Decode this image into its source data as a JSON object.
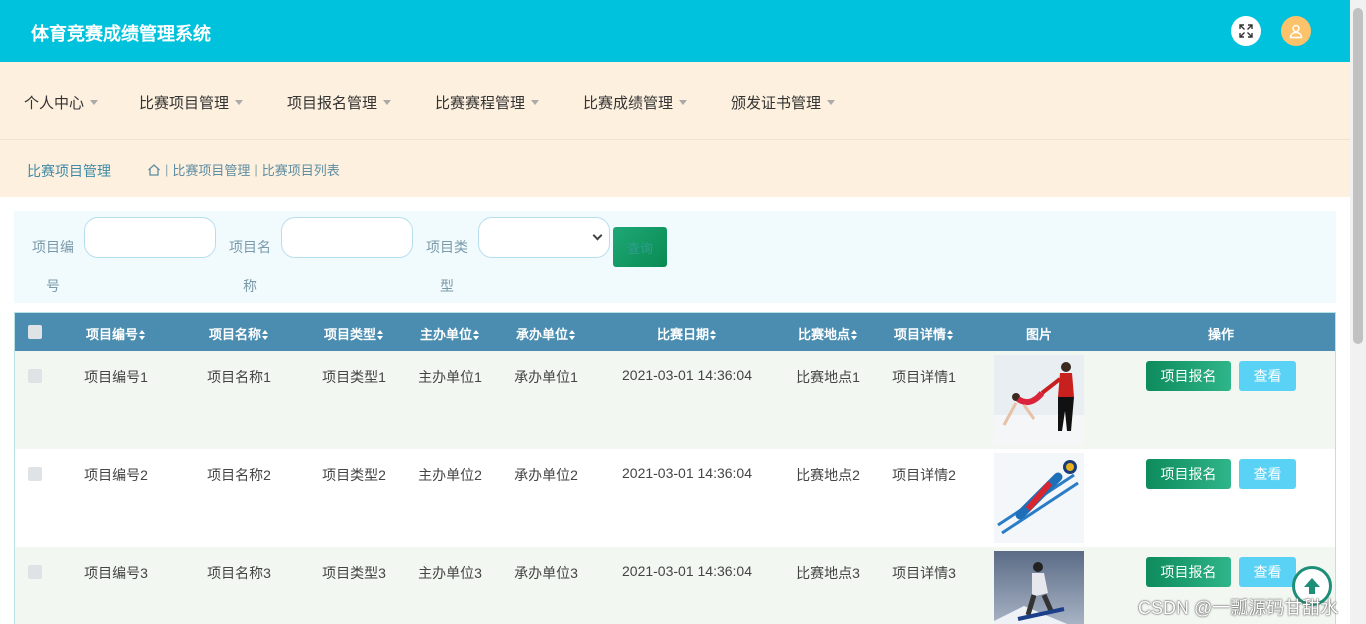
{
  "header": {
    "title": "体育竞赛成绩管理系统",
    "fullscreen_icon": "expand-icon",
    "user_icon": "user-icon",
    "user_color": "#fcc36a",
    "bg_color": "#00c2dc"
  },
  "nav": {
    "items": [
      {
        "label": "个人中心"
      },
      {
        "label": "比赛项目管理"
      },
      {
        "label": "项目报名管理"
      },
      {
        "label": "比赛赛程管理"
      },
      {
        "label": "比赛成绩管理"
      },
      {
        "label": "颁发证书管理"
      }
    ]
  },
  "breadcrumb": {
    "title": "比赛项目管理",
    "home_icon": "home-icon",
    "sep": "|",
    "level1": "比赛项目管理",
    "level2": "比赛项目列表"
  },
  "search": {
    "field1_label": "项目编号",
    "field2_label": "项目名称",
    "field3_label": "项目类型",
    "field1_value": "",
    "field2_value": "",
    "field3_value": "",
    "query_label": "查询"
  },
  "table": {
    "headers": [
      "项目编号",
      "项目名称",
      "项目类型",
      "主办单位",
      "承办单位",
      "比赛日期",
      "比赛地点",
      "项目详情",
      "图片",
      "操作"
    ],
    "rows": [
      {
        "code": "项目编号1",
        "name": "项目名称1",
        "type": "项目类型1",
        "host": "主办单位1",
        "org": "承办单位1",
        "date": "2021-03-01 14:36:04",
        "place": "比赛地点1",
        "detail": "项目详情1",
        "image": "figure-skating-pair-photo"
      },
      {
        "code": "项目编号2",
        "name": "项目名称2",
        "type": "项目类型2",
        "host": "主办单位2",
        "org": "承办单位2",
        "date": "2021-03-01 14:36:04",
        "place": "比赛地点2",
        "detail": "项目详情2",
        "image": "ski-jumping-photo"
      },
      {
        "code": "项目编号3",
        "name": "项目名称3",
        "type": "项目类型3",
        "host": "主办单位3",
        "org": "承办单位3",
        "date": "2021-03-01 14:36:04",
        "place": "比赛地点3",
        "detail": "项目详情3",
        "image": "snowboard-photo"
      }
    ],
    "enroll_label": "项目报名",
    "view_label": "查看"
  },
  "watermark": "CSDN @一瓢源码甘甜水",
  "back_top_icon": "arrow-up-icon"
}
